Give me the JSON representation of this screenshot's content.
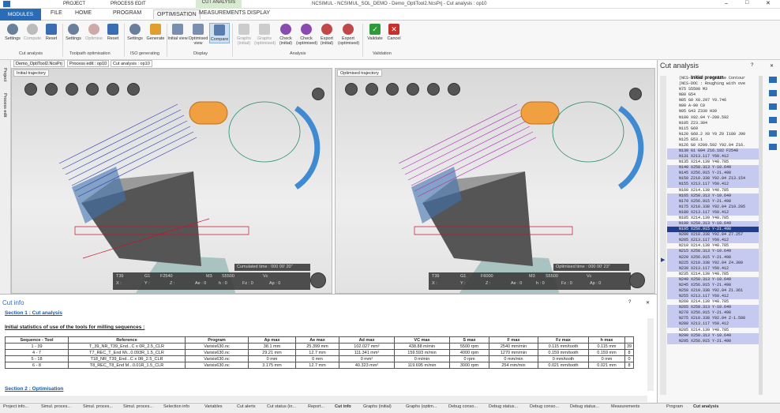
{
  "window": {
    "title": "NCSIMUL - NCSIMUL_SOL_DEMO - Demo_OptiTool2.NcsPrj - Cut analysis : op10",
    "contextual_tab": "CUT ANALYSIS"
  },
  "top_tabs": [
    "PROJECT",
    "PROCESS EDIT"
  ],
  "ribbon_tabs": [
    "MODULES",
    "FILE",
    "HOME",
    "PROGRAM",
    "OPTIMISATION",
    "MEASUREMENTS",
    "DISPLAY"
  ],
  "ribbon": {
    "buttons": [
      "Settings",
      "Compute",
      "Reset",
      "Settings",
      "Optimise",
      "Reset",
      "Settings",
      "Generate",
      "Initial view",
      "Optimised view",
      "Compare",
      "Graphs (initial)",
      "Graphs (optimised)",
      "Check (initial)",
      "Check (optimised)",
      "Export (initial)",
      "Export (optimised)",
      "Validate",
      "Cancel"
    ],
    "groups": [
      "Cut analysis",
      "Toolpath optimisation",
      "ISO generating",
      "Display",
      "Analysis",
      "Validation"
    ]
  },
  "doc_tabs": [
    "Demo_OptiTool2.NcsPrj",
    "Process edit : op10",
    "Cut analysis : op10"
  ],
  "sidebar_labels": [
    "Project",
    "Process edit"
  ],
  "viewport_left": {
    "title": "Initial trajectory",
    "status": "Cumulated time : 000 00' 20''",
    "hud": [
      "T39",
      "G1",
      "F2540",
      "M3",
      "S5500",
      "Vc",
      "X :",
      "Y :",
      "Z :",
      "Ae : 0",
      "h : 0",
      "Fz : 0",
      "Ap : 0"
    ]
  },
  "viewport_right": {
    "title": "Optimised trajectory",
    "status": "Optimised time : 000 00' 23''",
    "hud": [
      "T39",
      "G1",
      "F6000",
      "M3",
      "S5500",
      "Vc",
      "X :",
      "Y :",
      "Z :",
      "Ae : 0",
      "h : 0",
      "Fz : 0",
      "Ap : 0"
    ]
  },
  "cut_info": {
    "panel_title": "Cut info",
    "section1": "Section 1 : Cut analysis",
    "heading": "Initial statistics of use of the tools for milling sequences :",
    "columns": [
      "Sequence - Tool",
      "Reference",
      "Program",
      "Ap max",
      "Ae max",
      "Ad max",
      "VC max",
      "S max",
      "F max",
      "Fz max",
      "h max"
    ],
    "rows": [
      [
        "1 - 39",
        "T_39_NR_T39_End...C x 0R_2.5_CLR",
        "Varixis630.nc",
        "38.1 mm",
        "25.399 mm",
        "102.027 mm²",
        "438.88 m/min",
        "5500 rpm",
        "2540 mm/min",
        "0.115 mm/tooth",
        "0.115 mm",
        "39"
      ],
      [
        "4 - 7",
        "T7_REC_T_End Mi...0.093R_1.5_CLR",
        "Varixis630.nc",
        "29.21 mm",
        "12.7 mm",
        "111.341 mm²",
        "159.593 m/min",
        "4000 rpm",
        "1270 mm/min",
        "0.159 mm/tooth",
        "0.159 mm",
        "8"
      ],
      [
        "5 - 18",
        "T18_NR_T39_End...C x 0R_2.5_CLR",
        "Varixis630.nc",
        "0 mm",
        "0 mm",
        "0 mm²",
        "0 m/min",
        "0 rpm",
        "0 mm/min",
        "0 mm/tooth",
        "0 mm",
        "0"
      ],
      [
        "6 - 8",
        "T8_REC_T8_End M...0.01R_1.5_CLR",
        "Varixis630.nc",
        "3.175 mm",
        "12.7 mm",
        "40.323 mm²",
        "119.695 m/min",
        "3000 rpm",
        "254 mm/min",
        "0.021 mm/tooth",
        "0.021 mm",
        "8"
      ]
    ],
    "section2": "Section 2 : Optimisation"
  },
  "right_panel": {
    "title": "Cut analysis",
    "program_title": "Initial program",
    "lines": [
      "(NCS-START : Profile Contour",
      "(NCS-DOC : Roughing with ove",
      "N75 S5500 M3",
      "N80 G54",
      "N85 G0 X0.297 Y0.746",
      "N90 A-90 C0",
      "N95 G43 Z330 H39",
      "N100 X92.04 Y-209.592",
      "N105 Z23.304",
      "N115 G69",
      "N120 G68.2 X0 Y0 Z0 I180 J90",
      "N125 G53.1",
      "N126 G0 X209.592 Y92.04 Z16.",
      "N130 G1 G94  Z16.102 F2540",
      "N131 X213.117 Y60.412",
      "N135 X214.139 Y48.785",
      "N140 X250.313 Y-10.649",
      "N145 X256.915 Y-21.498",
      "N150 Z210.338 Y92.04 Z13.154",
      "N155 X213.117 Y60.412",
      "N160 X214.139 Y48.785",
      "N165 X250.313 Y-10.649",
      "N170 X256.915 Y-21.498",
      "N175 X210.338 Y92.04 Z10.205",
      "N180 X213.117 Y60.412",
      "N185 X214.139 Y48.785",
      "N190 X250.313 Y-10.649",
      "N195 X256.915 Y-21.498",
      "N200 X210.338 Y92.04 Z7.257",
      "N205 X213.117 Y60.412",
      "N210 X214.139 Y48.785",
      "N215 X250.313 Y-10.649",
      "N220 X256.915 Y-21.498",
      "N225 X210.338 Y92.04 Z4.309",
      "N230 X213.117 Y60.412",
      "N235 X214.139 Y48.785",
      "N240 X250.313 Y-10.649",
      "N245 X256.915 Y-21.498",
      "N250 X210.338 Y92.04 Z1.361",
      "N255 X213.117 Y60.412",
      "N260 X214.139 Y48.785",
      "N265 X250.313 Y-10.649",
      "N270 X256.915 Y-21.498",
      "N275 X210.338 Y92.04 Z-1.588",
      "N280 X213.117 Y60.412",
      "N285 X214.139 Y48.785",
      "N290 X250.313 Y-10.649",
      "N295 X256.915 Y-21.498"
    ]
  },
  "bottom_tabs": [
    "Project info...",
    "Simul. proces...",
    "Simul. proces...",
    "Simul. proces...",
    "Selection info",
    "Variables",
    "Cut alerts",
    "Cut status (in...",
    "Report...",
    "Cut info",
    "Graphs (initial)",
    "Graphs (optim...",
    "Debug conso...",
    "Debug status...",
    "Debug conso...",
    "Debug status...",
    "Measurements"
  ],
  "right_bottom_tabs": [
    "Program",
    "Cut analysis"
  ]
}
